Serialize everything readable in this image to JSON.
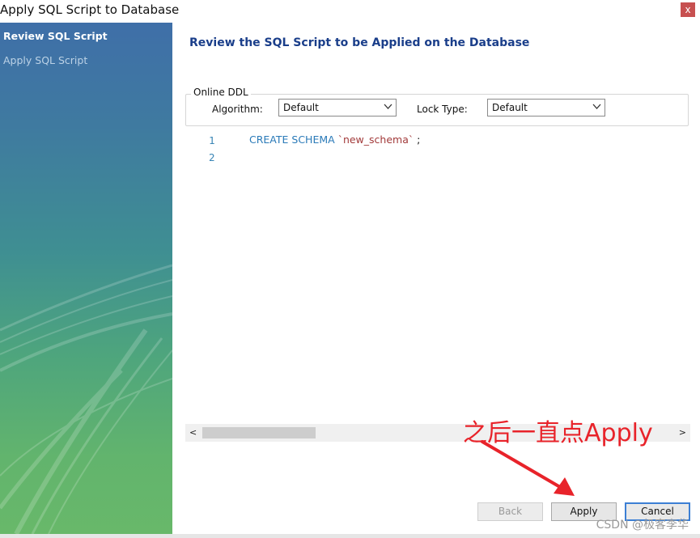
{
  "window": {
    "title": "Apply SQL Script to Database",
    "close_label": "x"
  },
  "sidebar": {
    "items": [
      {
        "label": "Review SQL Script",
        "active": true
      },
      {
        "label": "Apply SQL Script",
        "active": false
      }
    ]
  },
  "main": {
    "heading": "Review the SQL Script to be Applied on the Database",
    "online_ddl": {
      "legend": "Online DDL",
      "algorithm_label": "Algorithm:",
      "algorithm_value": "Default",
      "lock_type_label": "Lock Type:",
      "lock_type_value": "Default"
    },
    "editor": {
      "line_numbers": [
        "1",
        "2"
      ],
      "code": {
        "keyword": "CREATE SCHEMA",
        "identifier": "`new_schema`",
        "terminator": ";"
      }
    },
    "scrollbar": {
      "left_arrow": "<",
      "right_arrow": ">"
    }
  },
  "annotation": {
    "text": "之后一直点Apply",
    "color": "#e8232a"
  },
  "buttons": {
    "back": "Back",
    "apply": "Apply",
    "cancel": "Cancel"
  },
  "watermark": "CSDN @极客李华",
  "colors": {
    "accent": "#1a3e8a",
    "keyword": "#2a7ab8",
    "string": "#a23a3a",
    "default_button_border": "#3c7fd4"
  }
}
